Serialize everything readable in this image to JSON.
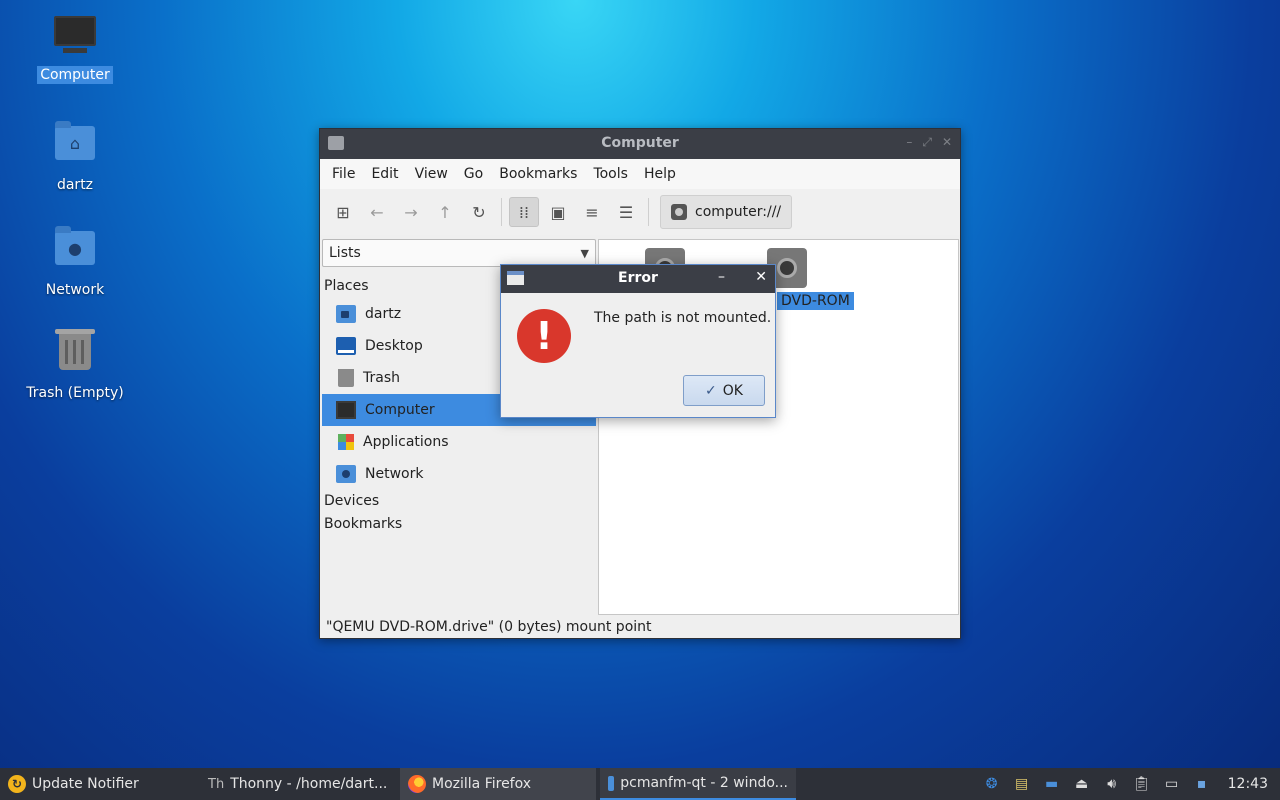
{
  "desktop": {
    "icons": [
      {
        "label": "Computer"
      },
      {
        "label": "dartz"
      },
      {
        "label": "Network"
      },
      {
        "label": "Trash (Empty)"
      }
    ]
  },
  "window": {
    "title": "Computer",
    "menu": [
      "File",
      "Edit",
      "View",
      "Go",
      "Bookmarks",
      "Tools",
      "Help"
    ],
    "path": "computer:///",
    "side_combo": "Lists",
    "sections": {
      "places": "Places",
      "devices": "Devices",
      "bookmarks": "Bookmarks"
    },
    "places": [
      "dartz",
      "Desktop",
      "Trash",
      "Computer",
      "Applications",
      "Network"
    ],
    "selected_place": "Computer",
    "file_label": "DVD-ROM",
    "status": "\"QEMU DVD-ROM.drive\" (0 bytes) mount point"
  },
  "dialog": {
    "title": "Error",
    "message": "The path is not mounted.",
    "ok_label": "OK"
  },
  "taskbar": {
    "tasks": [
      "Update Notifier",
      "Thonny  -  /home/dart...",
      "Mozilla Firefox",
      "pcmanfm-qt - 2 windo..."
    ],
    "clock": "12:43"
  },
  "colors": {
    "accent": "#3d8be0",
    "titlebar": "#3b3e46",
    "taskbar": "#2d3038",
    "error_red": "#d9372c"
  }
}
